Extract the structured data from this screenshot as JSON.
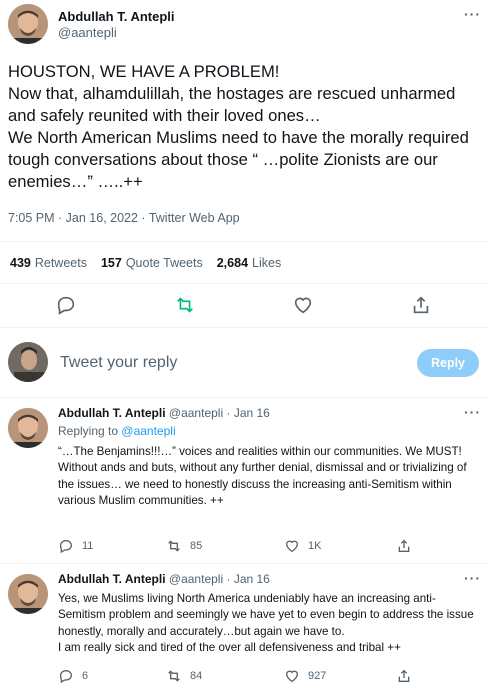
{
  "main_tweet": {
    "author_name": "Abdullah T. Antepli",
    "author_handle": "@aantepli",
    "text": "HOUSTON, WE HAVE A PROBLEM!\nNow that, alhamdulillah, the hostages are rescued unharmed and safely reunited with their loved ones…\nWe North American Muslims need to have the morally required tough conversations about those “ …polite Zionists are our enemies…” …..++",
    "meta": "7:05 PM · Jan 16, 2022 · Twitter Web App",
    "stats": {
      "retweets_count": "439",
      "retweets_label": "Retweets",
      "quotes_count": "157",
      "quotes_label": "Quote Tweets",
      "likes_count": "2,684",
      "likes_label": "Likes"
    },
    "more_label": "···"
  },
  "reply_box": {
    "placeholder": "Tweet your reply",
    "button_label": "Reply"
  },
  "replies": [
    {
      "author_name": "Abdullah T. Antepli",
      "author_handle": "@aantepli",
      "date": "Jan 16",
      "replying_prefix": "Replying to",
      "replying_handle": "@aantepli",
      "text": "“…The Benjamins!!!…” voices and realities within our communities. We MUST!\nWithout ands and buts, without any further denial, dismissal and or trivializing of the issues… we need to honestly discuss the increasing anti-Semitism within various Muslim communities. ++",
      "reply_count": "11",
      "retweet_count": "85",
      "like_count": "1K"
    },
    {
      "author_name": "Abdullah T. Antepli",
      "author_handle": "@aantepli",
      "date": "Jan 16",
      "text": "Yes, we Muslims living North America undeniably have an increasing anti-Semitism problem and seemingly we have yet to even begin to address the issue honestly, morally and accurately…but again we have to.\nI am really sick and tired of the over all defensiveness and tribal ++",
      "reply_count": "6",
      "retweet_count": "84",
      "like_count": "927"
    }
  ],
  "colors": {
    "accent": "#1d9bf0",
    "retweet_green": "#00ba7c",
    "secondary_text": "#536471",
    "reply_button_disabled": "#8ecdf8"
  },
  "icons": [
    "reply-icon",
    "retweet-icon",
    "like-icon",
    "share-icon",
    "more-icon",
    "avatar"
  ]
}
